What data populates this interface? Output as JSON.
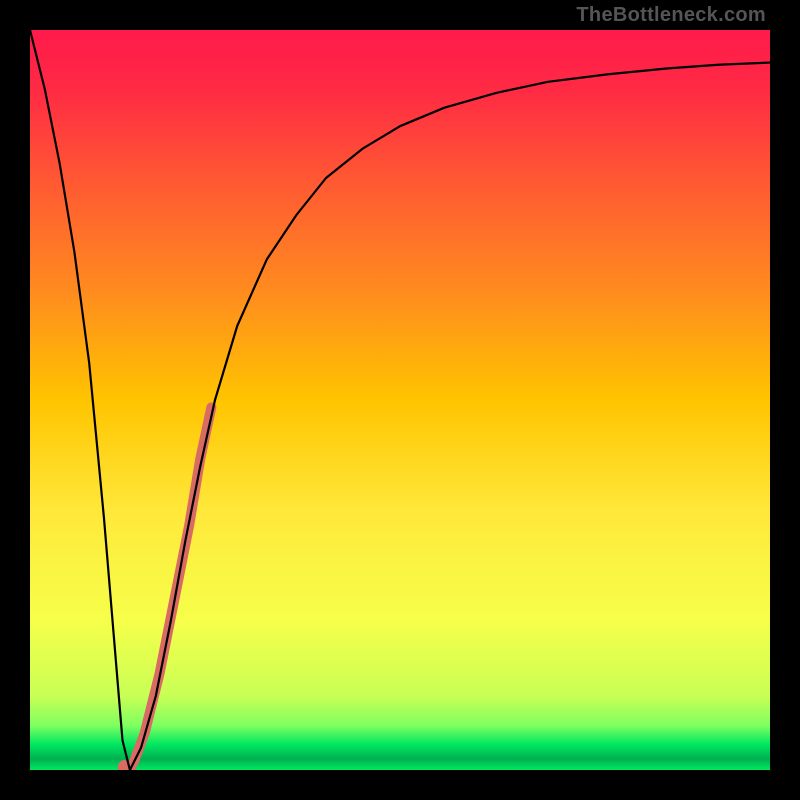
{
  "watermark": "TheBottleneck.com",
  "gradient": {
    "stops": [
      {
        "offset": 0.0,
        "color": "#ff1a4b"
      },
      {
        "offset": 0.08,
        "color": "#ff2a44"
      },
      {
        "offset": 0.2,
        "color": "#ff5733"
      },
      {
        "offset": 0.35,
        "color": "#ff8a1f"
      },
      {
        "offset": 0.5,
        "color": "#ffc400"
      },
      {
        "offset": 0.65,
        "color": "#ffe83a"
      },
      {
        "offset": 0.8,
        "color": "#f6ff4a"
      },
      {
        "offset": 0.9,
        "color": "#c8ff55"
      },
      {
        "offset": 0.94,
        "color": "#7fff60"
      },
      {
        "offset": 0.965,
        "color": "#00e860"
      },
      {
        "offset": 0.985,
        "color": "#00b050"
      },
      {
        "offset": 1.0,
        "color": "#00e860"
      }
    ]
  },
  "chart_data": {
    "type": "line",
    "title": "",
    "xlabel": "",
    "ylabel": "",
    "xlim": [
      0,
      100
    ],
    "ylim": [
      0,
      100
    ],
    "grid": false,
    "series": [
      {
        "name": "bottleneck-curve",
        "stroke": "#000000",
        "stroke_width": 2.2,
        "x": [
          0,
          2,
          4,
          6,
          8,
          10,
          11.5,
          12.5,
          13.5,
          15,
          17,
          19,
          21,
          23,
          25,
          28,
          32,
          36,
          40,
          45,
          50,
          56,
          63,
          70,
          78,
          86,
          93,
          100
        ],
        "y": [
          100,
          92,
          82,
          70,
          55,
          34,
          16,
          4,
          0,
          3,
          10,
          20,
          31,
          41,
          50,
          60,
          69,
          75,
          80,
          84,
          87,
          89.5,
          91.5,
          93,
          94,
          94.8,
          95.3,
          95.6
        ]
      },
      {
        "name": "highlight-segment",
        "stroke": "#d96b63",
        "stroke_width": 10,
        "linecap": "round",
        "x": [
          14.0,
          15.5,
          17.5,
          19.5,
          21.5,
          23.0,
          24.5
        ],
        "y": [
          1.0,
          5.0,
          13.0,
          23.0,
          33.0,
          42.0,
          49.0
        ]
      },
      {
        "name": "highlight-dot",
        "stroke": "#d96b63",
        "stroke_width": 14,
        "linecap": "round",
        "x": [
          12.8,
          13.4
        ],
        "y": [
          0.4,
          0.0
        ]
      }
    ]
  }
}
